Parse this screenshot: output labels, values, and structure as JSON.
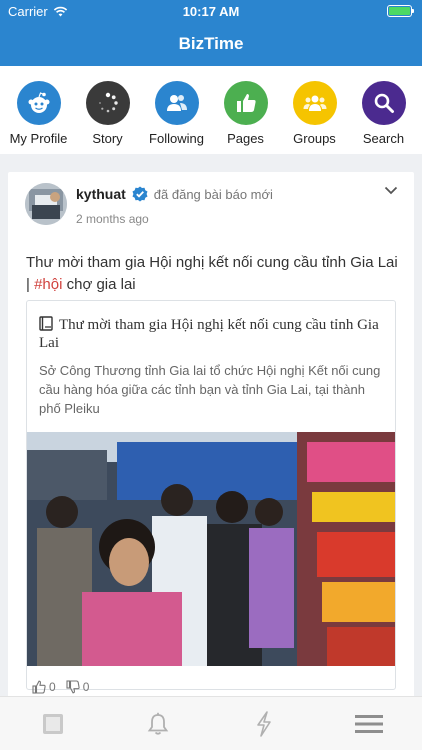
{
  "status_bar": {
    "carrier": "Carrier",
    "time": "10:17 AM",
    "battery_level": 1.0
  },
  "app": {
    "title": "BizTime"
  },
  "shortcuts": [
    {
      "label": "My Profile",
      "icon": "reddit-alien-icon",
      "color": "#2b85cf"
    },
    {
      "label": "Story",
      "icon": "spinner-icon",
      "color": "#3a3a3a"
    },
    {
      "label": "Following",
      "icon": "users-icon",
      "color": "#2b85cf"
    },
    {
      "label": "Pages",
      "icon": "thumbs-up-icon",
      "color": "#4caf50"
    },
    {
      "label": "Groups",
      "icon": "group-icon",
      "color": "#f5c400"
    },
    {
      "label": "Search",
      "icon": "search-icon",
      "color": "#4b2a8f"
    }
  ],
  "post": {
    "author": "kythuat",
    "verified": true,
    "action": "đã đăng bài báo mới",
    "time_ago": "2 months ago",
    "text": "Thư mời tham gia Hội nghị kết nối cung cầu tỉnh Gia Lai | ",
    "hashtag": "#hội",
    "text_after": " chợ gia lai",
    "link": {
      "icon": "book-icon",
      "title": "Thư mời tham gia Hội nghị kết nối cung cầu tỉnh Gia Lai",
      "description": "Sở Công Thương tỉnh Gia lai tổ chức Hội nghị Kết nối cung cầu hàng hóa giữa các tỉnh bạn và tỉnh Gia Lai, tại thành phố Pleiku"
    },
    "likes": "0",
    "dislikes": "0"
  },
  "tab_bar": {
    "tabs": [
      "home-icon",
      "bell-icon",
      "lightning-icon",
      "menu-icon"
    ]
  },
  "colors": {
    "primary": "#2b85cf",
    "hashtag": "#d0423e",
    "verified": "#2b85cf"
  }
}
